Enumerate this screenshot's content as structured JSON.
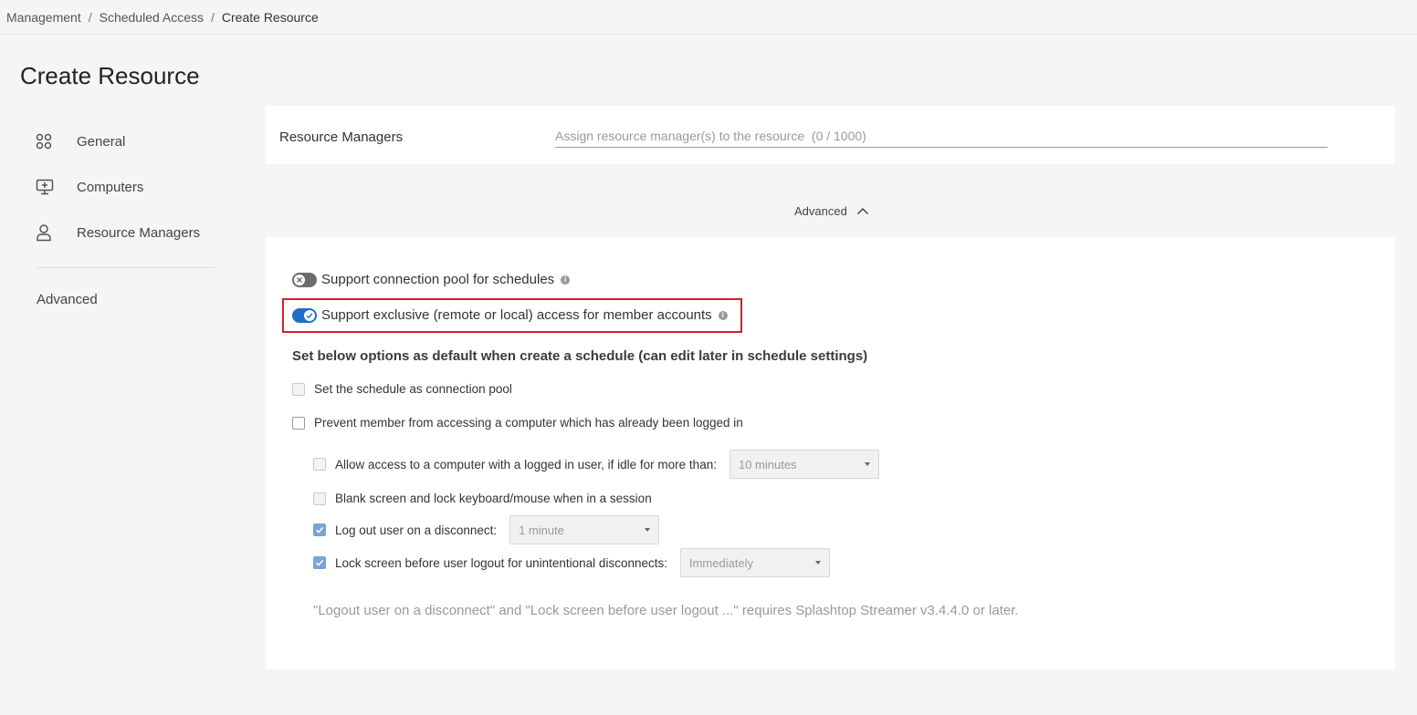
{
  "breadcrumb": {
    "items": [
      "Management",
      "Scheduled Access",
      "Create Resource"
    ],
    "separator": "/"
  },
  "page_title": "Create Resource",
  "sidebar": {
    "items": [
      {
        "label": "General",
        "icon": "grid-circles-icon"
      },
      {
        "label": "Computers",
        "icon": "monitor-plus-icon"
      },
      {
        "label": "Resource Managers",
        "icon": "user-icon"
      }
    ],
    "advanced_label": "Advanced"
  },
  "resource_managers": {
    "label": "Resource Managers",
    "placeholder": "Assign resource manager(s) to the resource  (0 / 1000)"
  },
  "advanced_toggle": {
    "label": "Advanced",
    "icon": "chevron-up-icon"
  },
  "advanced": {
    "switches": [
      {
        "label": "Support connection pool for schedules",
        "on": false
      },
      {
        "label": "Support exclusive (remote or local) access for member accounts",
        "on": true
      }
    ],
    "section_heading": "Set below options as default when create a schedule (can edit later in schedule settings)",
    "options": {
      "connection_pool": {
        "label": "Set the schedule as connection pool",
        "checked": false,
        "disabled": true
      },
      "prevent_access": {
        "label": "Prevent member from accessing a computer which has already been logged in",
        "checked": false,
        "disabled": false
      },
      "allow_idle": {
        "label": "Allow access to a computer with a logged in user, if idle for more than:",
        "checked": false,
        "disabled": true,
        "select": "10 minutes"
      },
      "blank_screen": {
        "label": "Blank screen and lock keyboard/mouse when in a session",
        "checked": false,
        "disabled": true
      },
      "logout_disconnect": {
        "label": "Log out user on a disconnect:",
        "checked": true,
        "disabled": true,
        "select": "1 minute"
      },
      "lock_screen": {
        "label": "Lock screen before user logout for unintentional disconnects:",
        "checked": true,
        "disabled": true,
        "select": "Immediately"
      }
    },
    "note": "\"Logout user on a disconnect\" and \"Lock screen before user logout ...\" requires Splashtop Streamer v3.4.4.0 or later."
  },
  "colors": {
    "accent": "#1d6fcb",
    "highlight": "#d3212d",
    "checked": "#7aa3d6"
  }
}
